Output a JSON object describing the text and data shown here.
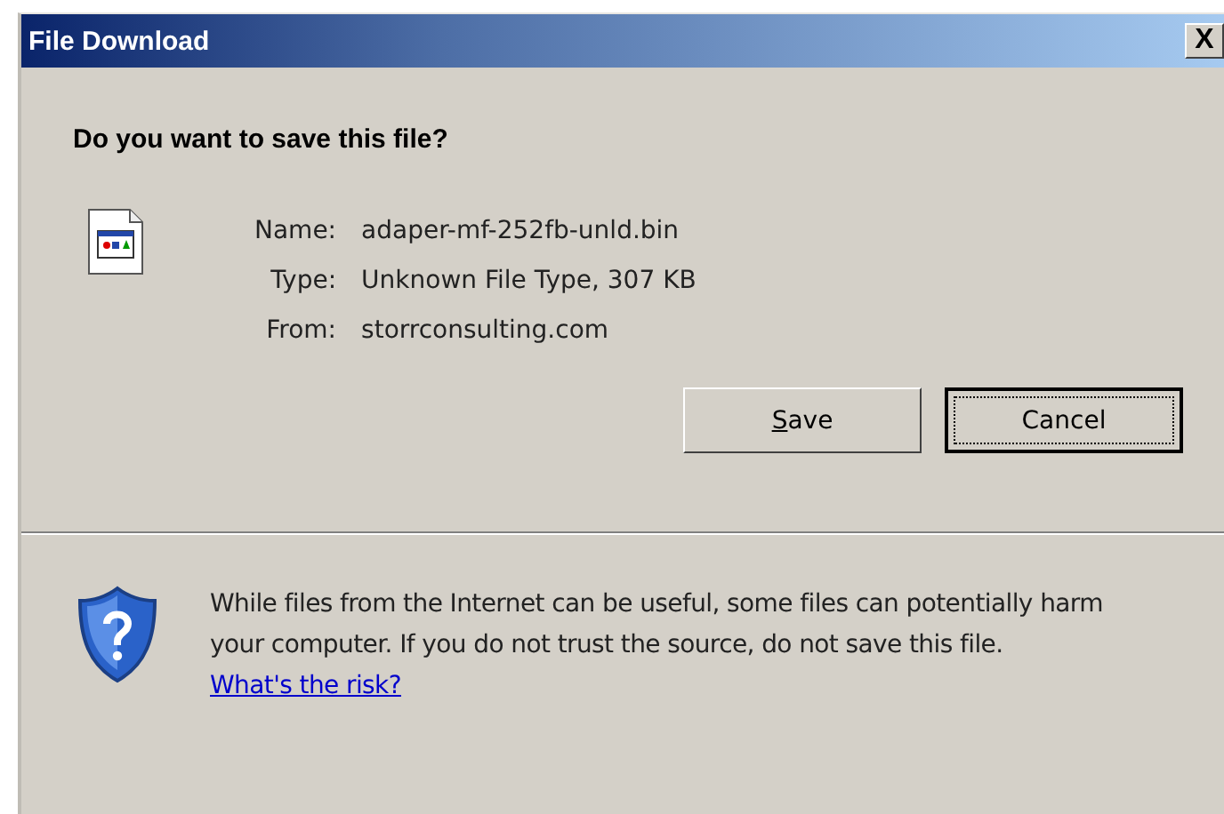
{
  "window": {
    "title": "File Download",
    "close_label": "X"
  },
  "question": "Do you want to save this file?",
  "details": [
    {
      "label": "Name:",
      "value": "adaper-mf-252fb-unld.bin"
    },
    {
      "label": "Type:",
      "value": "Unknown File Type, 307 KB"
    },
    {
      "label": "From:",
      "value": "storrconsulting.com"
    }
  ],
  "buttons": [
    {
      "label": "Save",
      "mnemonic_underlined": true,
      "focused": false
    },
    {
      "label": "Cancel",
      "mnemonic_underlined": false,
      "focused": true
    }
  ],
  "warning": {
    "text": "While files from the Internet can be useful, some files can potentially harm your computer. If you do not trust the source, do not save this file.",
    "link": "What's the risk?"
  }
}
